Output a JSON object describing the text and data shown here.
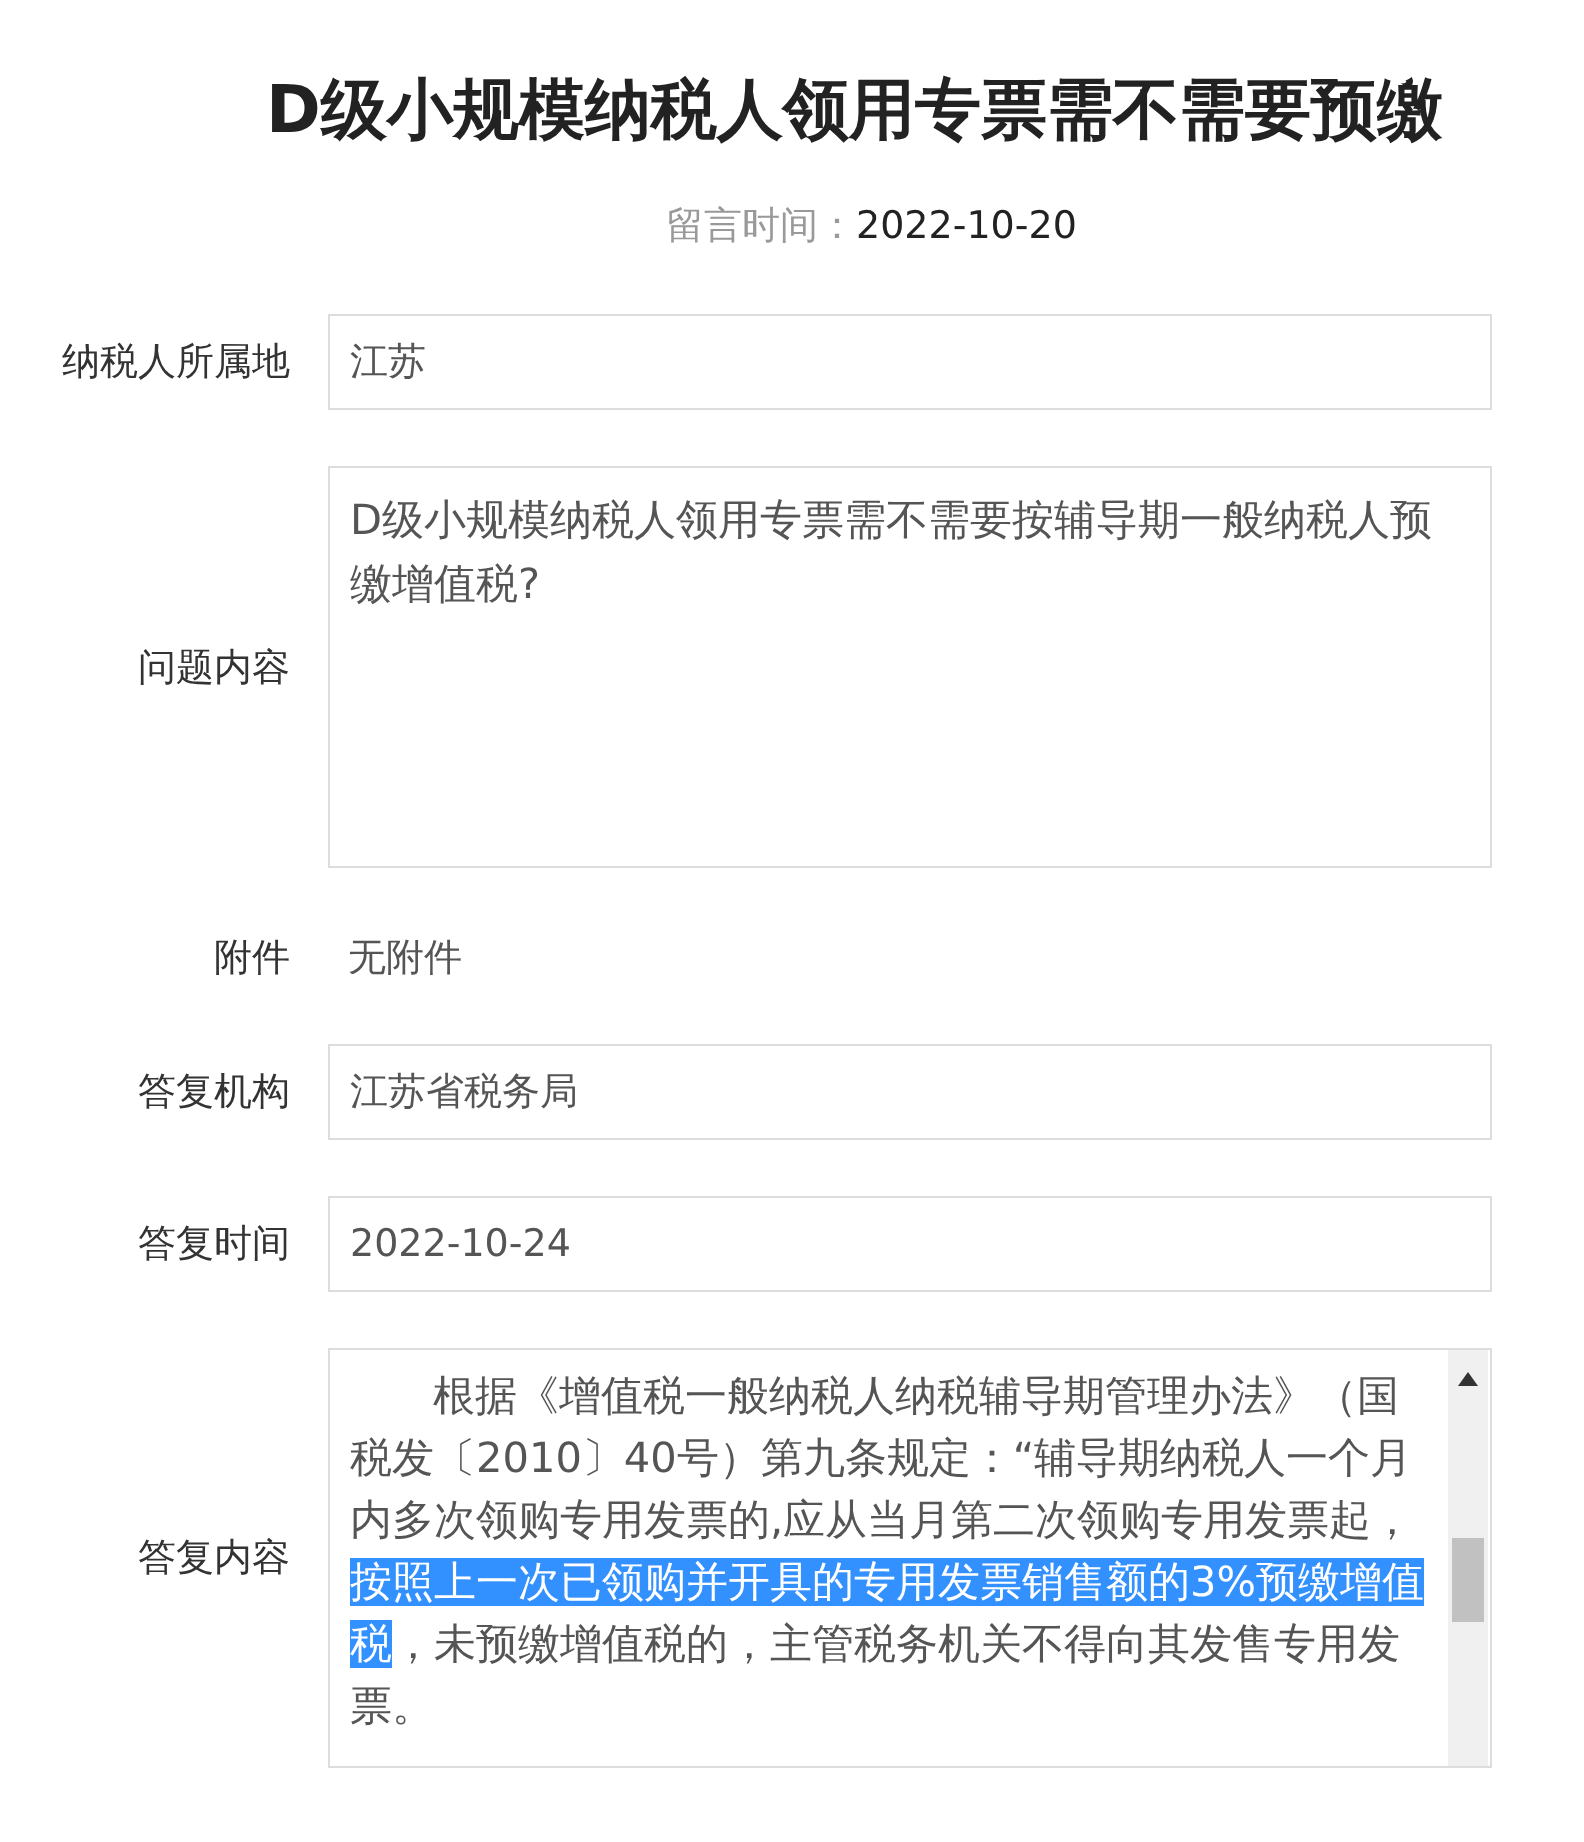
{
  "title": "D级小规模纳税人领用专票需不需要预缴",
  "message_time": {
    "label": "留言时间：",
    "value": "2022-10-20"
  },
  "fields": [
    {
      "kind": "input",
      "label": "纳税人所属地",
      "value": "江苏"
    },
    {
      "kind": "textarea",
      "label": "问题内容",
      "value": "D级小规模纳税人领用专票需不需要按辅导期一般纳税人预缴增值税?"
    },
    {
      "kind": "plain",
      "label": "附件",
      "value": "无附件"
    },
    {
      "kind": "input",
      "label": "答复机构",
      "value": "江苏省税务局"
    },
    {
      "kind": "input",
      "label": "答复时间",
      "value": "2022-10-24"
    },
    {
      "kind": "answer",
      "label": "答复内容",
      "segments": [
        {
          "text": "根据《增值税一般纳税人纳税辅导期管理办法》（国税发〔2010〕40号）第九条规定：“辅导期纳税人一个月内多次领购专用发票的,应从当月第二次领购专用发票起，",
          "selected": false
        },
        {
          "text": "按照上一次已领购并开具的专用发票销售额的3%预缴增值税",
          "selected": true
        },
        {
          "text": "，未预缴增值税的，主管税务机关不得向其发售专用发票。",
          "selected": false
        }
      ]
    }
  ]
}
